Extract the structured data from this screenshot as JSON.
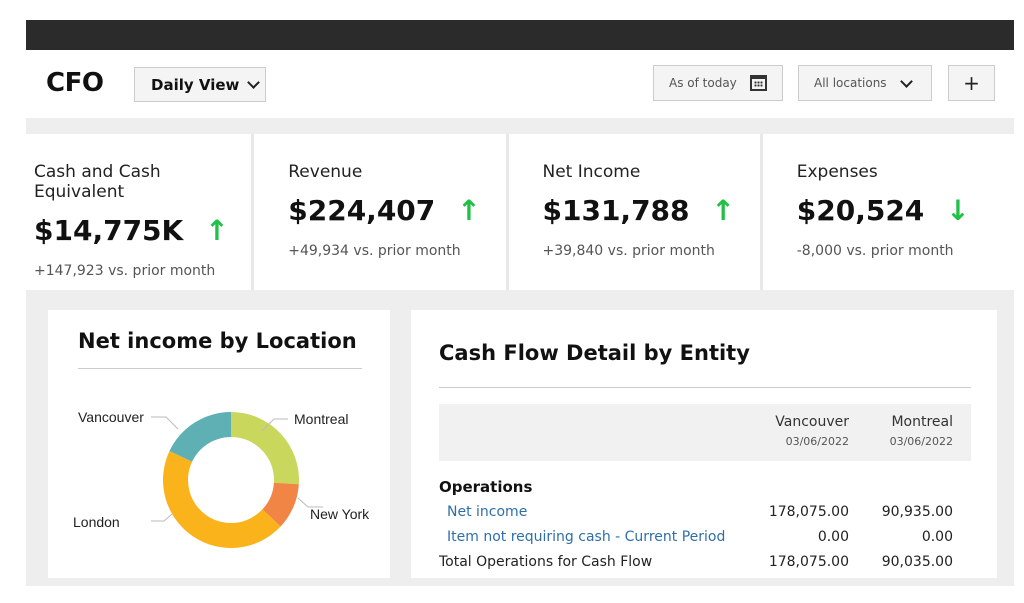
{
  "header": {
    "logo": "CFO",
    "view_select": "Daily View",
    "date_filter": "As of today",
    "location_filter": "All locations",
    "add_label": "+"
  },
  "kpis": [
    {
      "title": "Cash and Cash Equivalent",
      "value": "$14,775K",
      "trend": "up",
      "delta": "+147,923 vs. prior month"
    },
    {
      "title": "Revenue",
      "value": "$224,407",
      "trend": "up",
      "delta": "+49,934 vs. prior month"
    },
    {
      "title": "Net Income",
      "value": "$131,788",
      "trend": "up",
      "delta": "+39,840 vs. prior month"
    },
    {
      "title": "Expenses",
      "value": "$20,524",
      "trend": "down",
      "delta": "-8,000 vs. prior month"
    }
  ],
  "donut_card": {
    "title": "Net income by Location",
    "labels": {
      "vancouver": "Vancouver",
      "montreal": "Montreal",
      "new_york": "New York",
      "london": "London"
    }
  },
  "chart_data": {
    "type": "pie",
    "title": "Net income by Location",
    "series": [
      {
        "name": "Montreal",
        "value": 26,
        "color": "#c9d85c"
      },
      {
        "name": "New York",
        "value": 11,
        "color": "#f08545"
      },
      {
        "name": "London",
        "value": 45,
        "color": "#fbb31c"
      },
      {
        "name": "Vancouver",
        "value": 18,
        "color": "#5fb0b4"
      }
    ]
  },
  "table_card": {
    "title": "Cash Flow Detail by Entity",
    "columns": [
      {
        "name": "Vancouver",
        "date": "03/06/2022"
      },
      {
        "name": "Montreal",
        "date": "03/06/2022"
      }
    ],
    "section": "Operations",
    "rows": [
      {
        "label": "Net income",
        "v1": "178,075.00",
        "v2": "90,935.00",
        "link": true
      },
      {
        "label": "Item not requiring cash - Current Period",
        "v1": "0.00",
        "v2": "0.00",
        "link": true
      },
      {
        "label": "Total Operations for Cash Flow",
        "v1": "178,075.00",
        "v2": "90,035.00",
        "link": false
      }
    ]
  },
  "colors": {
    "up_arrow": "#21c046",
    "down_arrow": "#21c046",
    "link": "#2f6fa8"
  }
}
